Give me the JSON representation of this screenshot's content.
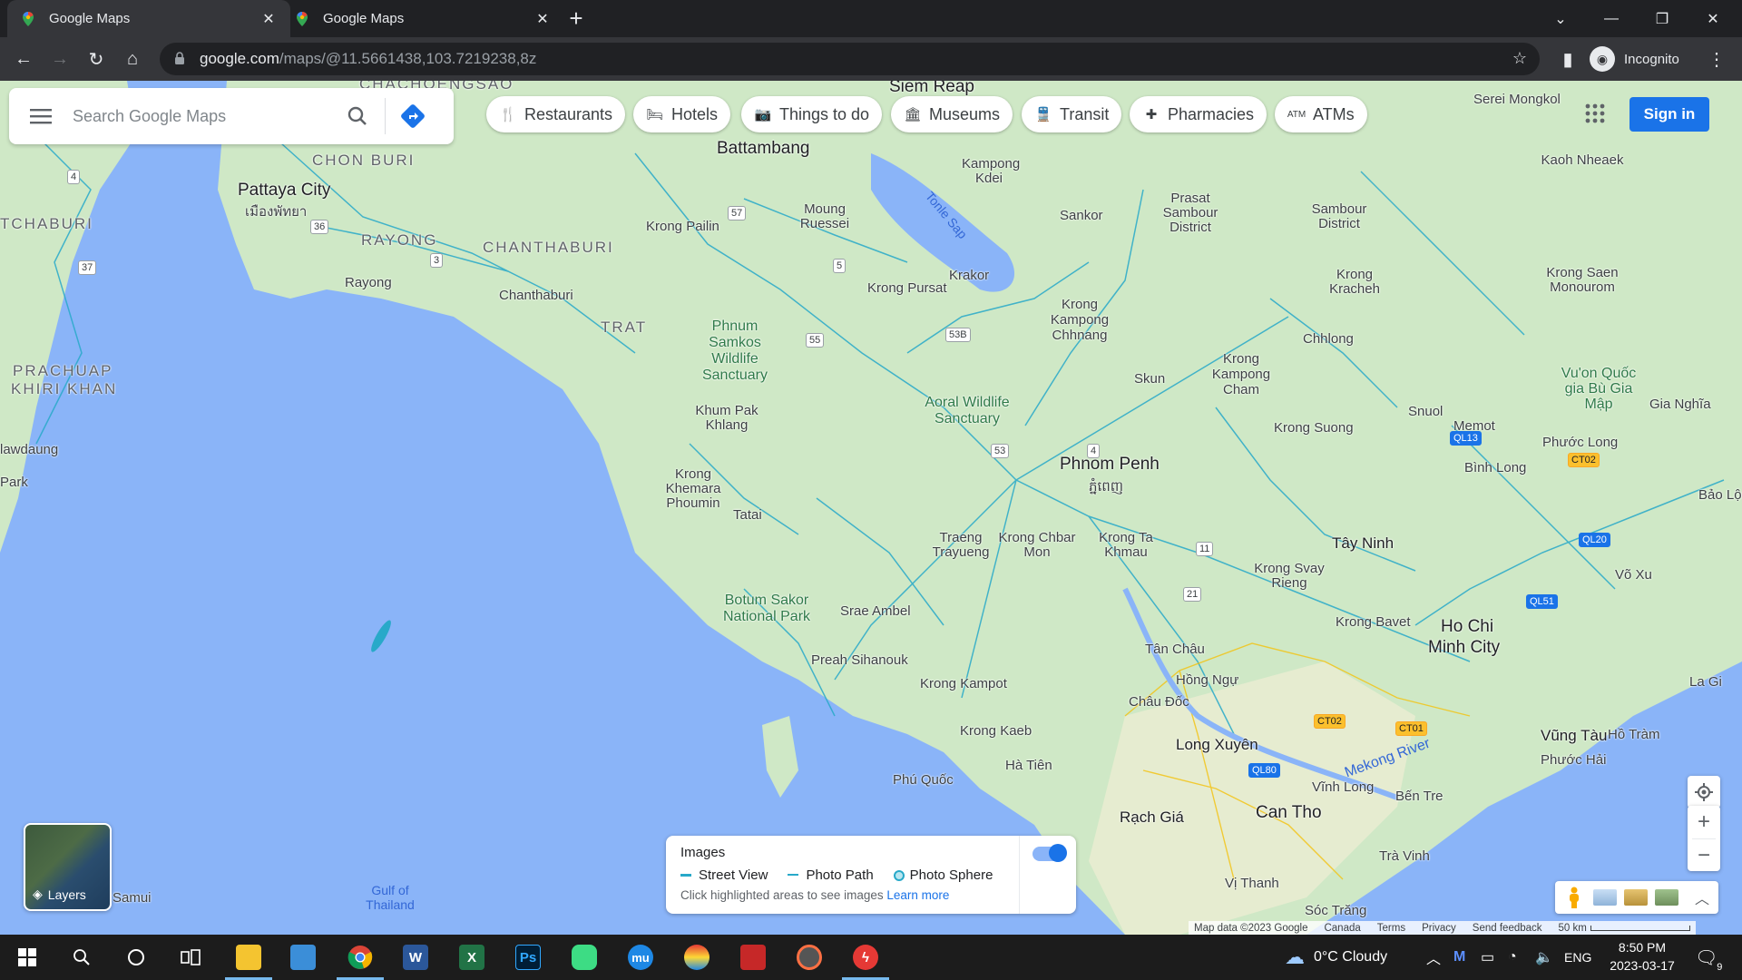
{
  "browser": {
    "tabs": [
      {
        "title": "Google Maps",
        "active": true
      },
      {
        "title": "Google Maps",
        "active": false
      }
    ],
    "new_tab": "+",
    "url_host": "google.com",
    "url_path": "/maps/@11.5661438,103.7219238,8z",
    "profile_label": "Incognito"
  },
  "search": {
    "placeholder": "Search Google Maps"
  },
  "chips": [
    {
      "label": "Restaurants",
      "icon": "restaurant-icon"
    },
    {
      "label": "Hotels",
      "icon": "hotel-icon"
    },
    {
      "label": "Things to do",
      "icon": "camera-icon"
    },
    {
      "label": "Museums",
      "icon": "museum-icon"
    },
    {
      "label": "Transit",
      "icon": "transit-icon"
    },
    {
      "label": "Pharmacies",
      "icon": "pharmacy-icon"
    },
    {
      "label": "ATMs",
      "icon": "atm-icon"
    }
  ],
  "account": {
    "sign_in": "Sign in"
  },
  "map_labels": {
    "phnom_penh": "Phnom Penh",
    "phnom_penh_km": "ភ្នំពេញ",
    "ho_chi_minh": "Ho Chi",
    "ho_chi_minh2": "Minh City",
    "battambang": "Battambang",
    "siem_reap": "Siem Reap",
    "pattaya": "Pattaya City",
    "pattaya_th": "เมืองพัทยา",
    "chon_buri": "CHON BURI",
    "rayong": "RAYONG",
    "chanthaburi": "CHANTHABURI",
    "trat": "TRAT",
    "chachoengsao": "CHACHOENGSAO",
    "prachuap": "PRACHUAP",
    "khiri_khan": "KHIRI KHAN",
    "tchaburi": "TCHABURI",
    "tonle_sap": "Tonle Sap",
    "phnum_samkos": "Phnum Samkos Wildlife Sanctuary",
    "aoral": "Aoral Wildlife Sanctuary",
    "botum_sakor": "Botum Sakor National Park",
    "gulf": "Gulf of Thailand",
    "mekong": "Mekong River",
    "can_tho": "Can Tho",
    "long_xuyen": "Long Xuyên",
    "rach_gia": "Rạch Giá",
    "vung_tau": "Vũng Tàu",
    "tay_ninh": "Tây Ninh",
    "preah_sihanouk": "Preah Sihanouk",
    "phu_quoc": "Phú Quốc",
    "krong_kampot": "Krong Kampot",
    "krong_kaeb": "Krong Kaeb",
    "ha_tien": "Hà Tiên",
    "chau_doc": "Châu Đốc",
    "hong_ngu": "Hồng Ngự",
    "tan_chau": "Tân Châu",
    "vinh_long": "Vĩnh Long",
    "ben_tre": "Bến Tre",
    "tra_vinh": "Trà Vinh",
    "soc_trang": "Sóc Trăng",
    "vi_thanh": "Vị Thanh",
    "binh_long": "Bình Long",
    "phuoc_long": "Phước Long",
    "kampong_cham": "Krong Kampong Cham",
    "kampong_chhnang": "Krong Kampong Chhnang",
    "krong_pursat": "Krong Pursat",
    "krong_pailin": "Krong Pailin",
    "moung_ruessei": "Moung Ruessei",
    "khum_pak_khlang": "Khum Pak Khlang",
    "krong_khemara": "Krong Khemara Phoumin",
    "tatai": "Tatai",
    "srae_ambel": "Srae Ambel",
    "kratie": "Krong Kracheh",
    "chhlong": "Chhlong",
    "skun": "Skun",
    "memot": "Memot",
    "snuol": "Snuol",
    "sambour": "Sambour District",
    "prasat_sambour": "Prasat Sambour District",
    "sankor": "Sankor",
    "krong_saen": "Krong Saen Monourom",
    "kaoh_nheaek": "Kaoh Nheaek",
    "serei_mongkol": "Serei Mongkol",
    "bao_loc": "Bảo Lộc",
    "gia_nghia": "Gia Nghĩa",
    "dong_xoai": "Vu'on Quốc gia Bù Gia Mập",
    "krong_svay_rieng": "Krong Svay Rieng",
    "krong_bavet": "Krong Bavet",
    "krong_suong": "Krong Suong",
    "traeng_trayueng": "Traeng Trayueng",
    "chbar_mon": "Krong Chbar Mon",
    "krong_ta_khmau": "Krong Ta Khmau",
    "la_gi": "La Gi",
    "ho_tram": "Hồ Tràm",
    "phuoc_hai": "Phước Hải",
    "kampong": "Kampong Kdei",
    "krakor": "Krakor",
    "rayong_city": "Rayong",
    "chanthaburi_city": "Chanthaburi",
    "samui": "Samui",
    "ranong": "Park",
    "lawdaung": "lawdaung",
    "vo_xu": "Võ Xu"
  },
  "images_panel": {
    "title": "Images",
    "street_view": "Street View",
    "photo_path": "Photo Path",
    "photo_sphere": "Photo Sphere",
    "hint": "Click highlighted areas to see images",
    "learn_more": "Learn more",
    "toggle_on": true
  },
  "layers_label": "Layers",
  "attribution": {
    "map_data": "Map data ©2023 Google",
    "country": "Canada",
    "terms": "Terms",
    "privacy": "Privacy",
    "feedback": "Send feedback",
    "scale": "50 km"
  },
  "taskbar": {
    "weather": "0°C  Cloudy",
    "language": "ENG",
    "time": "8:50 PM",
    "date": "2023-03-17",
    "notifications": "9"
  },
  "colors": {
    "land": "#cfe8c6",
    "water": "#8ab4f8",
    "roads": "#28a9c9",
    "accent": "#1a73e8"
  }
}
